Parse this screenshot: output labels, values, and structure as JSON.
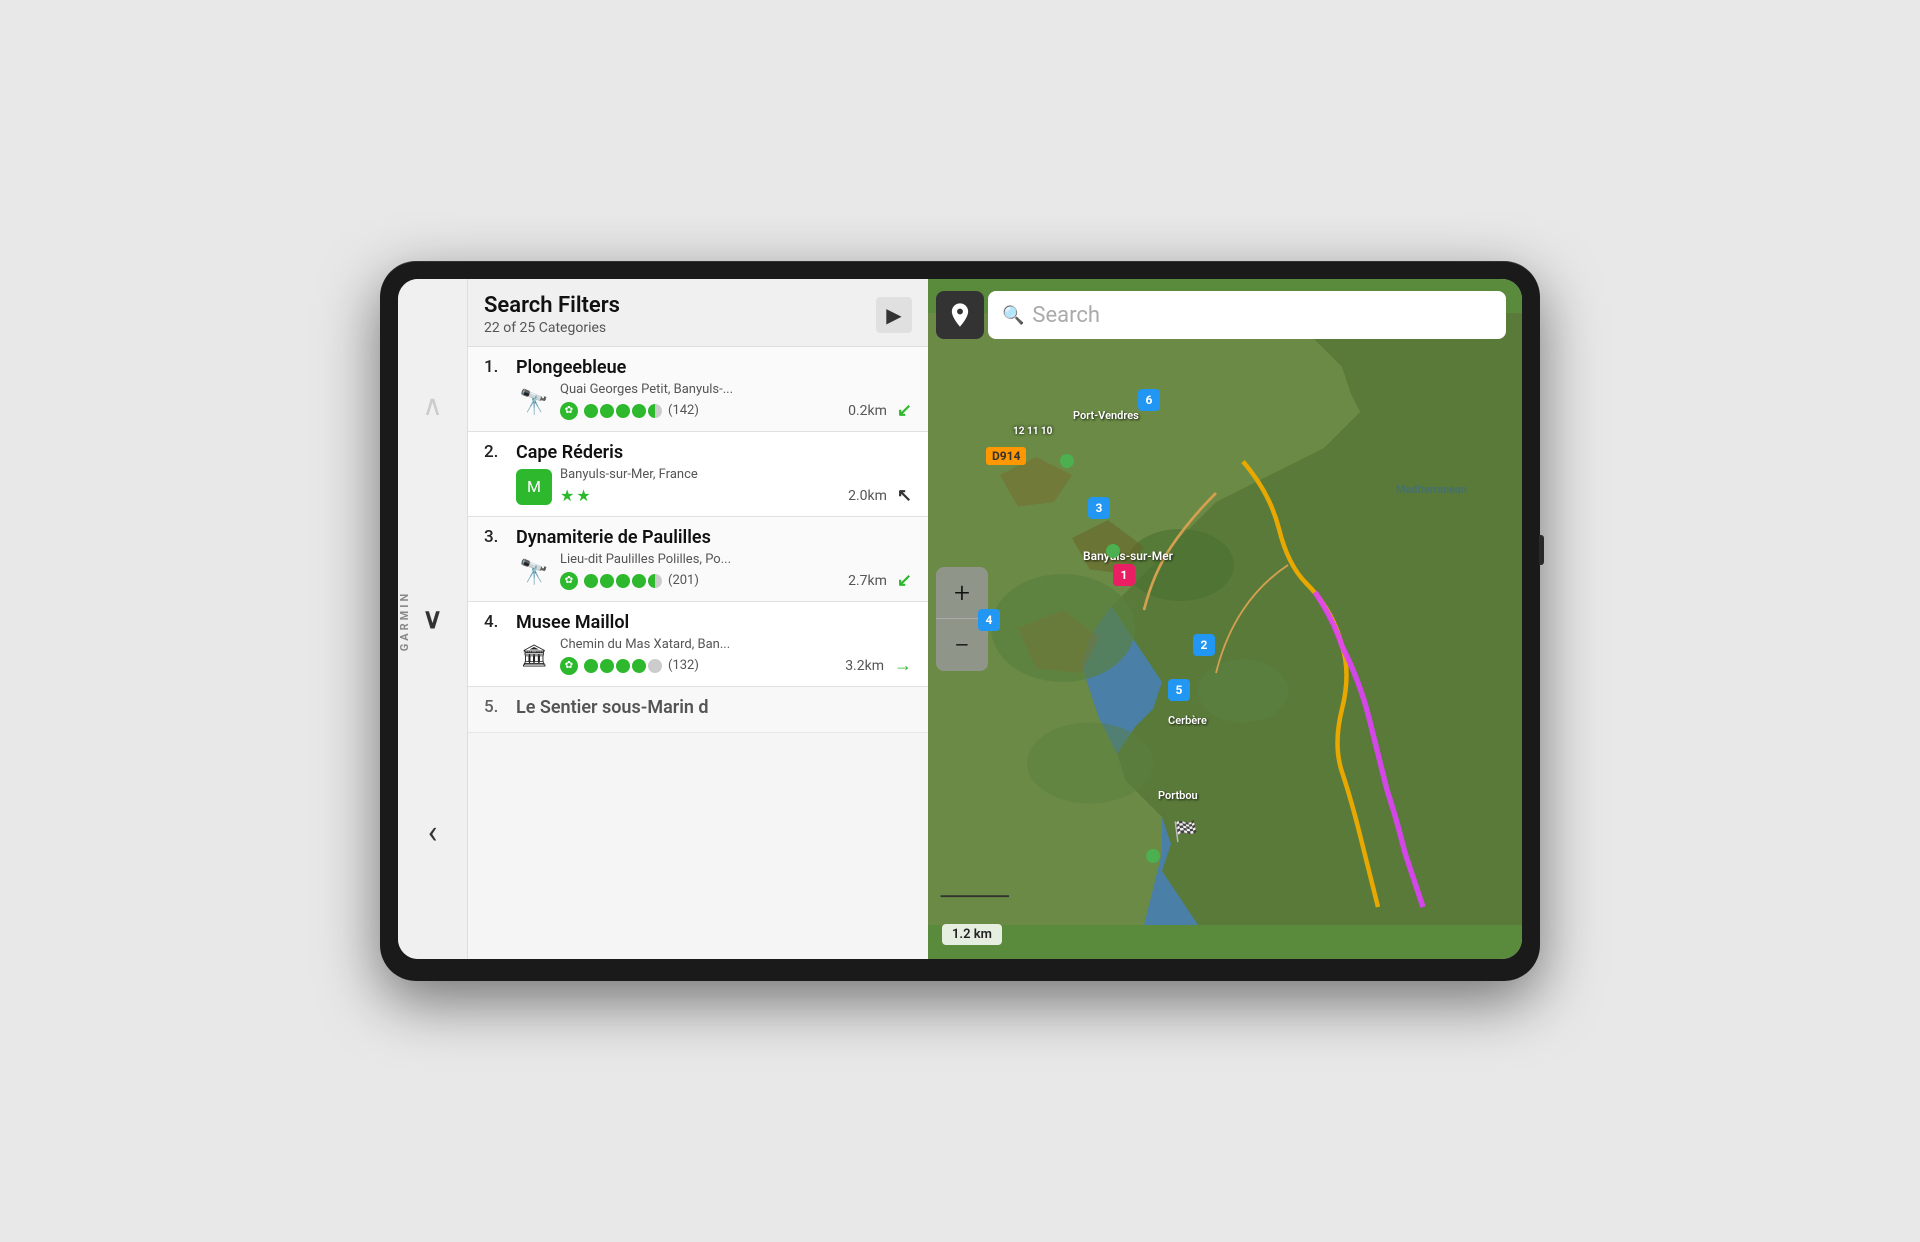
{
  "device": {
    "brand": "GARMIN"
  },
  "header": {
    "title": "Search Filters",
    "subtitle": "22 of 25 Categories",
    "arrow_label": "▶"
  },
  "search": {
    "placeholder": "Search"
  },
  "results": [
    {
      "number": "1.",
      "name": "Plongeebleue",
      "address": "Quai Georges Petit, Banyuls-...",
      "review_count": "(142)",
      "distance": "0.2km",
      "rating_type": "dots",
      "rating_full": 4,
      "rating_half": 1,
      "direction": "↓",
      "direction_color": "green",
      "icon_type": "binoculars"
    },
    {
      "number": "2.",
      "name": "Cape Réderis",
      "address": "Banyuls-sur-Mer, France",
      "review_count": "",
      "distance": "2.0km",
      "rating_type": "stars",
      "rating_full": 2,
      "direction": "↑",
      "direction_color": "dark",
      "icon_type": "michelin"
    },
    {
      "number": "3.",
      "name": "Dynamiterie de Paulilles",
      "address": "Lieu-dit Paulilles Polilles, Po...",
      "review_count": "(201)",
      "distance": "2.7km",
      "rating_type": "dots",
      "rating_full": 4,
      "rating_half": 1,
      "direction": "↓",
      "direction_color": "green",
      "icon_type": "binoculars"
    },
    {
      "number": "4.",
      "name": "Musee Maillol",
      "address": "Chemin du Mas Xatard, Ban...",
      "review_count": "(132)",
      "distance": "3.2km",
      "rating_type": "dots",
      "rating_full": 4,
      "rating_half": 0,
      "direction": "→",
      "direction_color": "green",
      "icon_type": "museum"
    },
    {
      "number": "5.",
      "name": "Le Sentier sous-Marin d",
      "address": "",
      "review_count": "",
      "distance": "",
      "rating_type": "none",
      "direction": "",
      "icon_type": "none"
    }
  ],
  "map": {
    "scale": "1.2 km",
    "zoom_plus": "+",
    "zoom_minus": "−",
    "markers": [
      {
        "id": "1",
        "label": "1",
        "type": "numbered",
        "color": "#E91E63"
      },
      {
        "id": "2",
        "label": "2",
        "type": "blue"
      },
      {
        "id": "3",
        "label": "3",
        "type": "blue"
      },
      {
        "id": "4",
        "label": "4",
        "type": "blue"
      },
      {
        "id": "5",
        "label": "5",
        "type": "blue"
      },
      {
        "id": "6",
        "label": "6",
        "type": "blue"
      }
    ],
    "road_labels": [
      "D914"
    ],
    "city_labels": [
      "Port-Vendres",
      "Banyuls-sur-Mer",
      "Cerbère",
      "Portbou"
    ]
  },
  "nav": {
    "up_arrow": "∧",
    "down_arrow": "∨",
    "back_arrow": "‹"
  }
}
